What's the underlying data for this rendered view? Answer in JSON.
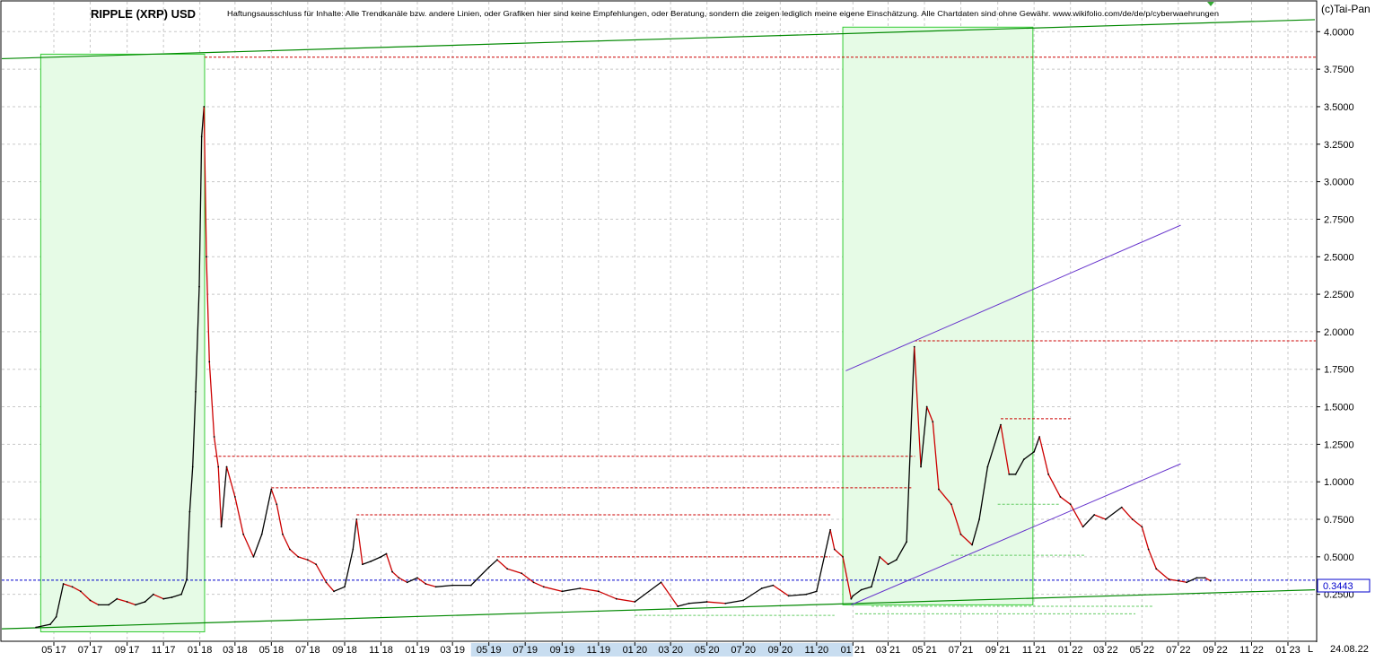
{
  "header": {
    "title": "RIPPLE (XRP) USD",
    "disclaimer": "Haftungsausschluss für Inhalte: Alle Trendkanäle bzw. andere Linien, oder Grafiken hier sind keine Empfehlungen, oder Beratung, sondern die zeigen lediglich meine eigene Einschätzung. Alle Chartdaten sind ohne Gewähr.  www.wikifolio.com/de/de/p/cyberwaehrungen",
    "copyright": "(c)Tai-Pan"
  },
  "footer": {
    "date": "24.08.22",
    "scale_marker": "L"
  },
  "colors": {
    "background": "#ffffff",
    "grid": "#c8c8c8",
    "price_line": "#000000",
    "down_candle": "#cc0000",
    "highlight_box_fill": "#e6fbe6",
    "highlight_box_stroke": "#33cc33",
    "trend_green": "#008800",
    "channel_purple": "#6633cc",
    "resistance_red": "#cc0000",
    "current_price_blue": "#0000cc",
    "time_axis_band": "#c8ddf0"
  },
  "chart_data": {
    "type": "line",
    "title": "RIPPLE (XRP) USD",
    "xlabel": "",
    "ylabel": "",
    "x_tick_labels": [
      "05 17",
      "07 17",
      "09 17",
      "11 17",
      "01 18",
      "03 18",
      "05 18",
      "07 18",
      "09 18",
      "11 18",
      "01 19",
      "03 19",
      "05 19",
      "07 19",
      "09 19",
      "11 19",
      "01 20",
      "03 20",
      "05 20",
      "07 20",
      "09 20",
      "11 20",
      "01 21",
      "03 21",
      "05 21",
      "07 21",
      "09 21",
      "11 21",
      "01 22",
      "03 22",
      "05 22",
      "07 22",
      "09 22",
      "11 22",
      "01 23"
    ],
    "y_tick_labels": [
      "4.0000",
      "3.7500",
      "3.5000",
      "3.2500",
      "3.0000",
      "2.7500",
      "2.5000",
      "2.2500",
      "2.0000",
      "1.7500",
      "1.5000",
      "1.2500",
      "1.0000",
      "0.7500",
      "0.5000",
      "0.2500"
    ],
    "ylim": [
      0.0,
      4.1
    ],
    "grid": true,
    "current_price": {
      "label": "0.3443",
      "value": 0.3443
    },
    "series": [
      {
        "values_note": "",
        "x": [
          "2017-04-01",
          "2017-04-25",
          "2017-05-05",
          "2017-05-17",
          "2017-06-01",
          "2017-06-15",
          "2017-07-01",
          "2017-07-15",
          "2017-08-01",
          "2017-08-15",
          "2017-09-01",
          "2017-09-15",
          "2017-10-01",
          "2017-10-15",
          "2017-11-01",
          "2017-11-15",
          "2017-12-01",
          "2017-12-10",
          "2017-12-15",
          "2017-12-20",
          "2017-12-25",
          "2017-12-31",
          "2018-01-04",
          "2018-01-08",
          "2018-01-12",
          "2018-01-17",
          "2018-01-25",
          "2018-02-01",
          "2018-02-06",
          "2018-02-15",
          "2018-03-01",
          "2018-03-15",
          "2018-04-01",
          "2018-04-15",
          "2018-05-01",
          "2018-05-10",
          "2018-05-20",
          "2018-06-01",
          "2018-06-15",
          "2018-07-01",
          "2018-07-15",
          "2018-08-01",
          "2018-08-14",
          "2018-09-01",
          "2018-09-15",
          "2018-09-21",
          "2018-10-01",
          "2018-10-15",
          "2018-11-01",
          "2018-11-10",
          "2018-11-20",
          "2018-12-01",
          "2018-12-15",
          "2019-01-01",
          "2019-01-15",
          "2019-02-01",
          "2019-03-01",
          "2019-04-01",
          "2019-05-01",
          "2019-05-15",
          "2019-06-01",
          "2019-06-25",
          "2019-07-15",
          "2019-08-01",
          "2019-09-01",
          "2019-10-01",
          "2019-11-01",
          "2019-12-01",
          "2020-01-01",
          "2020-02-14",
          "2020-03-13",
          "2020-04-01",
          "2020-05-01",
          "2020-06-01",
          "2020-07-01",
          "2020-08-01",
          "2020-08-20",
          "2020-09-15",
          "2020-10-15",
          "2020-11-01",
          "2020-11-24",
          "2020-12-01",
          "2020-12-15",
          "2020-12-29",
          "2021-01-01",
          "2021-01-15",
          "2021-02-01",
          "2021-02-15",
          "2021-03-01",
          "2021-03-15",
          "2021-04-01",
          "2021-04-14",
          "2021-04-25",
          "2021-05-05",
          "2021-05-15",
          "2021-05-25",
          "2021-06-15",
          "2021-07-01",
          "2021-07-20",
          "2021-08-01",
          "2021-08-15",
          "2021-09-06",
          "2021-09-20",
          "2021-10-01",
          "2021-10-15",
          "2021-11-01",
          "2021-11-10",
          "2021-11-25",
          "2021-12-15",
          "2022-01-01",
          "2022-01-22",
          "2022-02-10",
          "2022-03-01",
          "2022-03-28",
          "2022-04-15",
          "2022-05-01",
          "2022-05-12",
          "2022-05-25",
          "2022-06-15",
          "2022-07-01",
          "2022-07-15",
          "2022-08-01",
          "2022-08-15",
          "2022-08-24"
        ],
        "values": [
          0.03,
          0.05,
          0.1,
          0.32,
          0.3,
          0.27,
          0.21,
          0.18,
          0.18,
          0.22,
          0.2,
          0.18,
          0.2,
          0.25,
          0.22,
          0.23,
          0.25,
          0.35,
          0.8,
          1.1,
          1.6,
          2.3,
          3.3,
          3.5,
          2.5,
          1.8,
          1.3,
          1.1,
          0.7,
          1.1,
          0.9,
          0.65,
          0.5,
          0.65,
          0.95,
          0.85,
          0.65,
          0.55,
          0.5,
          0.48,
          0.45,
          0.33,
          0.27,
          0.3,
          0.55,
          0.75,
          0.45,
          0.47,
          0.5,
          0.52,
          0.4,
          0.36,
          0.33,
          0.36,
          0.32,
          0.3,
          0.31,
          0.31,
          0.43,
          0.48,
          0.42,
          0.39,
          0.33,
          0.3,
          0.27,
          0.29,
          0.27,
          0.22,
          0.2,
          0.33,
          0.17,
          0.19,
          0.2,
          0.19,
          0.21,
          0.29,
          0.31,
          0.24,
          0.25,
          0.27,
          0.68,
          0.55,
          0.5,
          0.22,
          0.24,
          0.28,
          0.3,
          0.5,
          0.45,
          0.48,
          0.6,
          1.9,
          1.1,
          1.5,
          1.4,
          0.95,
          0.85,
          0.65,
          0.58,
          0.75,
          1.1,
          1.38,
          1.05,
          1.05,
          1.15,
          1.2,
          1.3,
          1.05,
          0.9,
          0.85,
          0.7,
          0.78,
          0.75,
          0.83,
          0.75,
          0.7,
          0.55,
          0.42,
          0.35,
          0.34,
          0.33,
          0.36,
          0.36,
          0.34
        ]
      }
    ]
  }
}
